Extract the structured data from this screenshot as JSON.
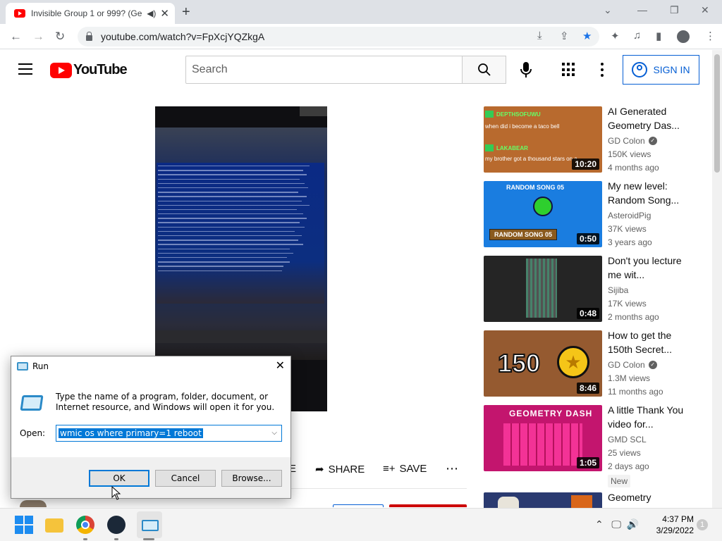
{
  "browser": {
    "tab_title": "Invisible Group 1 or 999? (Ge",
    "new_tab": "+",
    "url": "youtube.com/watch?v=FpXcjYQZkgA"
  },
  "youtube": {
    "logo_text": "YouTube",
    "search_placeholder": "Search",
    "signin_label": "SIGN IN",
    "actions": {
      "like_suffix": "KE",
      "share": "SHARE",
      "save": "SAVE"
    }
  },
  "recommendations": [
    {
      "title": "AI Generated Geometry Das...",
      "channel": "GD Colon",
      "verified": true,
      "views": "150K views",
      "age": "4 months ago",
      "duration": "10:20",
      "thumb_text": {
        "user1": "DEPTHSOFUWU",
        "comment1": "when did i become a taco bell",
        "user2": "LAKABEAR",
        "comment2": "my brother got a thousand stars on a"
      }
    },
    {
      "title": "My new level: Random Song...",
      "channel": "AsteroidPig",
      "verified": false,
      "views": "37K views",
      "age": "3 years ago",
      "duration": "0:50",
      "thumb_text": {
        "top": "RANDOM SONG 05",
        "label": "RANDOM SONG 05"
      }
    },
    {
      "title": "Don't you lecture me wit...",
      "channel": "Sijiba",
      "verified": false,
      "views": "17K views",
      "age": "2 months ago",
      "duration": "0:48"
    },
    {
      "title": "How to get the 150th Secret...",
      "channel": "GD Colon",
      "verified": true,
      "views": "1.3M views",
      "age": "11 months ago",
      "duration": "8:46",
      "thumb_text": {
        "number": "150"
      }
    },
    {
      "title": "A little Thank You video for...",
      "channel": "GMD SCL",
      "verified": false,
      "views": "25 views",
      "age": "2 days ago",
      "duration": "1:05",
      "badge": "New",
      "thumb_text": {
        "logo": "GEOMETRY DASH"
      }
    },
    {
      "title": "Geometry",
      "channel": "",
      "verified": false,
      "views": "",
      "age": "",
      "duration": ""
    }
  ],
  "run_dialog": {
    "title": "Run",
    "description": "Type the name of a program, folder, document, or Internet resource, and Windows will open it for you.",
    "open_label": "Open:",
    "command": "wmic os where primary=1 reboot",
    "ok": "OK",
    "cancel": "Cancel",
    "browse": "Browse..."
  },
  "taskbar": {
    "time": "4:37 PM",
    "date": "3/29/2022"
  }
}
